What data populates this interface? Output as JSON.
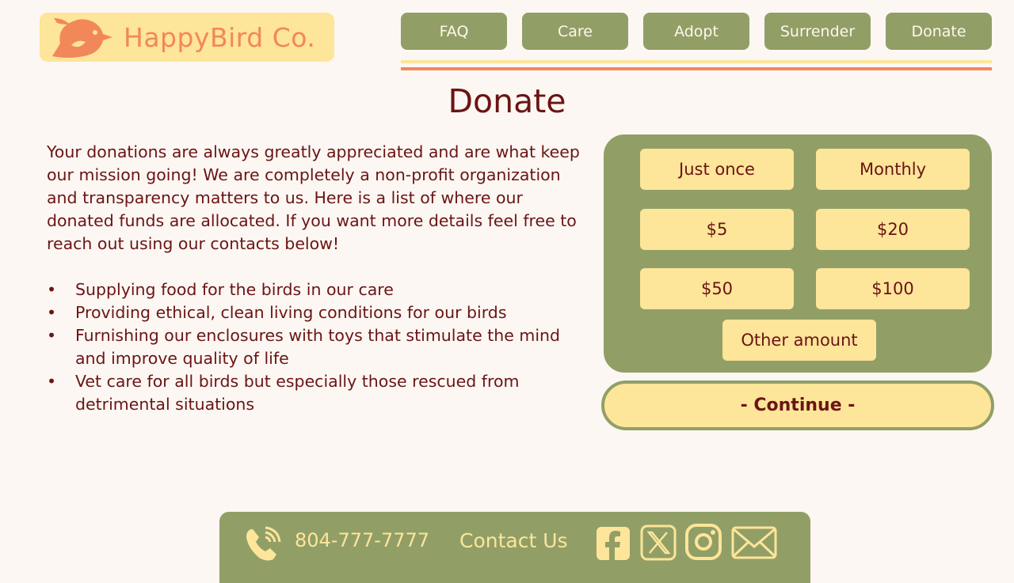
{
  "brand": {
    "name": "HappyBird Co."
  },
  "nav": {
    "items": [
      "FAQ",
      "Care",
      "Adopt",
      "Surrender",
      "Donate"
    ]
  },
  "page": {
    "title": "Donate"
  },
  "content": {
    "intro": "Your donations are always greatly appreciated and are what keep our mission going! We are completely a non-profit organization and transparency matters to us. Here is a list of where our donated funds are allocated. If you want more details feel free to reach out using our contacts below!",
    "allocations": [
      "Supplying food for the birds in our care",
      "Providing ethical, clean living conditions for our birds",
      "Furnishing our enclosures with toys that stimulate the mind and improve quality of life",
      "Vet care for all birds but especially those rescued from detrimental situations"
    ]
  },
  "donate": {
    "frequency": [
      "Just once",
      "Monthly"
    ],
    "amounts": [
      "$5",
      "$20",
      "$50",
      "$100"
    ],
    "other": "Other amount",
    "continue": "- Continue -"
  },
  "footer": {
    "phone": "804-777-7777",
    "contact": "Contact Us"
  },
  "icons": {
    "phone": "phone-icon",
    "facebook": "facebook-icon",
    "x": "x-icon",
    "instagram": "instagram-icon",
    "email": "mail-icon"
  },
  "colors": {
    "background": "#fcf7f3",
    "green": "#919f67",
    "yellow": "#fde59a",
    "orange": "#f2875a",
    "text": "#6b1414"
  }
}
